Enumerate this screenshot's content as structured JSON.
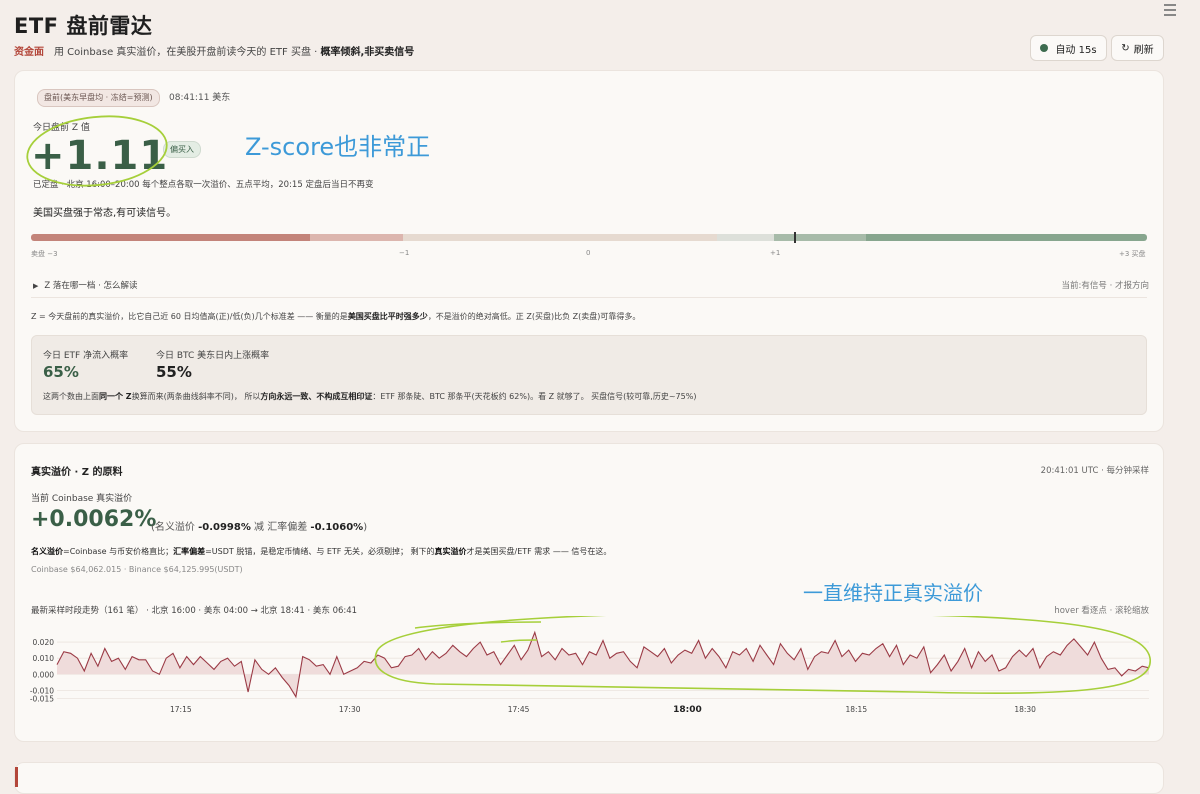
{
  "header": {
    "title": "ETF 盘前雷达",
    "tag": "资金面",
    "subtitle_pre": "用 Coinbase 真实溢价，在美股开盘前读今天的 ETF 买盘 ·",
    "subtitle_bold": "概率倾斜,非买卖信号",
    "auto_label": "自动 15s",
    "refresh_label": "刷新"
  },
  "radar": {
    "badge": "盘前(美东早盘均 · 冻结=预测)",
    "time": "08:41:11 美东",
    "z_label": "今日盘前 Z 值",
    "z_value": "+1.11",
    "z_badge": "偏买入",
    "z_sub": "已定盘 · 北京 16:00–20:00 每个整点各取一次溢价、五点平均，20:15 定盘后当日不再变",
    "z_desc": "美国买盘强于常态,有可读信号。",
    "scale_ticks": [
      "卖盘 −3",
      "−1",
      "0",
      "+1",
      "+3 买盘"
    ],
    "expander": "Z 落在哪一档 · 怎么解读",
    "current": "当前:有信号 · 才报方向",
    "expl_pre": "Z = 今天盘前的真实溢价，比它自己近 60 日均值高(正)/低(负)几个标准差 —— 衡量的是",
    "expl_bold": "美国买盘比平时强多少",
    "expl_post": "，不是溢价的绝对高低。正 Z(买盘)比负 Z(卖盘)可靠得多。",
    "prob1_label": "今日 ETF 净流入概率",
    "prob1_value": "65%",
    "prob2_label": "今日 BTC 美东日内上涨概率",
    "prob2_value": "55%",
    "note_1": "这两个数由上面",
    "note_b1": "同一个 Z",
    "note_2": "换算而来(两条曲线斜率不同)， 所以",
    "note_b2": "方向永远一致、不构成互相印证",
    "note_3": "：ETF 那条陡、BTC 那条平(天花板约 62%)。看 Z 就够了。 买盘信号(较可靠,历史~75%)"
  },
  "premium": {
    "title": "真实溢价 · Z 的原料",
    "time": "20:41:01 UTC · 每分钟采样",
    "label": "当前 Coinbase 真实溢价",
    "value": "+0.0062%",
    "paren_1": "(名义溢价",
    "paren_v1": "-0.0998%",
    "paren_2": "减 汇率偏差",
    "paren_v2": "-0.1060%",
    "paren_3": ")",
    "def_b1": "名义溢价",
    "def_1": "=Coinbase 与币安价格直比；",
    "def_b2": "汇率偏差",
    "def_2": "=USDT 脱锚，是稳定币情绪、与 ETF 无关，必须剔掉； 剩下的",
    "def_b3": "真实溢价",
    "def_3": "才是美国买盘/ETF 需求 —— 信号在这。",
    "prices": "Coinbase $64,062.015 · Binance $64,125.995(USDT)",
    "trend": "最新采样时段走势（161 笔） · 北京 16:00 · 美东 04:00 → 北京 18:41 · 美东 06:41",
    "hover": "hover 看逐点 · 滚轮缩放"
  },
  "annotations": {
    "a1": "Z-score也非常正",
    "a2": "一直维持正真实溢价"
  },
  "chart_data": {
    "type": "area",
    "x_ticks": [
      "17:15",
      "17:30",
      "17:45",
      "18:00",
      "18:15",
      "18:30"
    ],
    "y_ticks": [
      "0.020",
      "0.010",
      "0.000",
      "-0.010",
      "-0.015"
    ],
    "ylim": [
      -0.016,
      0.03
    ],
    "x_range_minutes": [
      1024,
      1121
    ],
    "x_tick_minutes": [
      1035,
      1050,
      1065,
      1080,
      1095,
      1110
    ],
    "values": [
      0.006,
      0.014,
      0.013,
      0.01,
      0.002,
      0.013,
      0.005,
      0.016,
      0.008,
      0.01,
      0.003,
      0.011,
      0.009,
      0.009,
      0.002,
      0.0,
      0.01,
      0.013,
      0.004,
      0.011,
      0.006,
      0.011,
      0.007,
      0.003,
      0.008,
      0.01,
      0.005,
      0.008,
      -0.011,
      0.009,
      0.003,
      0.0,
      0.004,
      -0.002,
      -0.007,
      -0.014,
      0.011,
      0.009,
      0.005,
      0.006,
      0.0,
      0.011,
      0.0,
      0.002,
      0.004,
      0.008,
      0.007,
      0.012,
      0.01,
      0.004,
      0.005,
      0.011,
      0.012,
      0.016,
      0.009,
      0.014,
      0.01,
      0.013,
      0.018,
      0.014,
      0.011,
      0.016,
      0.02,
      0.012,
      0.014,
      0.006,
      0.012,
      0.018,
      0.009,
      0.015,
      0.026,
      0.011,
      0.014,
      0.009,
      0.016,
      0.012,
      0.013,
      0.006,
      0.014,
      0.012,
      0.021,
      0.01,
      0.013,
      0.014,
      0.008,
      0.004,
      0.017,
      0.014,
      0.011,
      0.016,
      0.007,
      0.012,
      0.015,
      0.013,
      0.021,
      0.01,
      0.016,
      0.011,
      0.004,
      0.014,
      0.012,
      0.016,
      0.008,
      0.018,
      0.012,
      0.006,
      0.019,
      0.013,
      0.009,
      0.016,
      0.003,
      0.011,
      0.014,
      0.013,
      0.021,
      0.011,
      0.015,
      0.008,
      0.013,
      0.012,
      0.016,
      0.019,
      0.011,
      0.018,
      0.006,
      0.012,
      0.01,
      0.017,
      0.001,
      0.006,
      0.012,
      0.002,
      0.008,
      0.016,
      0.004,
      0.014,
      0.008,
      0.012,
      0.002,
      0.004,
      0.011,
      0.015,
      0.011,
      0.016,
      0.004,
      0.011,
      0.014,
      0.012,
      0.018,
      0.022,
      0.017,
      0.012,
      0.02,
      0.01,
      0.003,
      0.004,
      -0.001,
      0.003,
      0.002,
      0.005,
      0.004
    ]
  }
}
